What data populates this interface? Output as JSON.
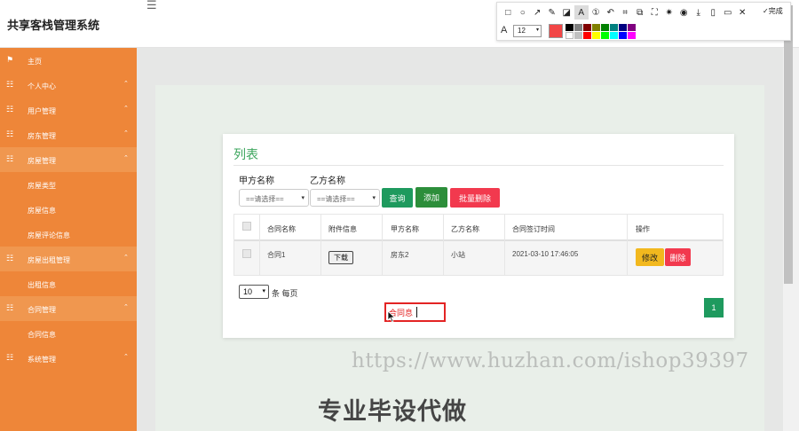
{
  "app": {
    "title": "共享客栈管理系统"
  },
  "sidebar": {
    "items": [
      {
        "label": "主页",
        "icon": "flag-icon",
        "type": "item",
        "arrow": ""
      },
      {
        "label": "个人中心",
        "icon": "grid-icon",
        "type": "item",
        "arrow": "⌃"
      },
      {
        "label": "用户管理",
        "icon": "grid-icon",
        "type": "item",
        "arrow": "⌃"
      },
      {
        "label": "房东管理",
        "icon": "grid-icon",
        "type": "item",
        "arrow": "⌃"
      },
      {
        "label": "房屋管理",
        "icon": "grid-icon",
        "type": "group",
        "arrow": "⌃"
      },
      {
        "label": "房屋类型",
        "type": "sub"
      },
      {
        "label": "房屋信息",
        "type": "sub"
      },
      {
        "label": "房屋评论信息",
        "type": "sub"
      },
      {
        "label": "房屋出租管理",
        "icon": "grid-icon",
        "type": "group",
        "arrow": "⌃"
      },
      {
        "label": "出租信息",
        "type": "sub"
      },
      {
        "label": "合同管理",
        "icon": "grid-icon",
        "type": "group",
        "arrow": "⌃"
      },
      {
        "label": "合同信息",
        "type": "sub"
      },
      {
        "label": "系统管理",
        "icon": "grid-icon",
        "type": "item",
        "arrow": "⌃"
      }
    ]
  },
  "main": {
    "card_title": "列表",
    "filters": {
      "party_a_label": "甲方名称",
      "party_a_value": "==请选择==",
      "party_b_label": "乙方名称",
      "party_b_value": "==请选择=="
    },
    "buttons": {
      "search": "查询",
      "add": "添加",
      "batch_delete": "批量删除"
    },
    "table": {
      "headers": [
        "合同名称",
        "附件信息",
        "甲方名称",
        "乙方名称",
        "合同签订时间",
        "操作"
      ],
      "rows": [
        {
          "contract_name": "合同1",
          "attachment": "下载",
          "party_a": "房东2",
          "party_b": "小站",
          "signed_at": "2021-03-10 17:46:05",
          "edit": "修改",
          "delete": "删除"
        }
      ]
    },
    "pager": {
      "page_size": "10",
      "per_page_text": "条 每页",
      "current_page": "1"
    }
  },
  "annotation": {
    "text": "合同息"
  },
  "overlay": {
    "watermark": "https://www.huzhan.com/ishop39397",
    "promo": "专业毕设代做"
  },
  "toolbar": {
    "icons": [
      "rectangle-icon",
      "ellipse-icon",
      "arrow-icon",
      "pen-icon",
      "mosaic-icon",
      "text-icon",
      "step-icon",
      "undo-icon",
      "crop-icon",
      "resize-icon",
      "fullscreen-icon",
      "pin-icon",
      "record-icon",
      "download-icon",
      "copy-icon",
      "bookmark-icon",
      "close-icon"
    ],
    "done_label": "完成",
    "font_size": "12",
    "current_color": "#f24646",
    "palette": [
      "#000000",
      "#808080",
      "#800000",
      "#808000",
      "#008000",
      "#008080",
      "#000080",
      "#800080",
      "#ffffff",
      "#c0c0c0",
      "#ff0000",
      "#ffff00",
      "#00ff00",
      "#00ffff",
      "#0000ff",
      "#ff00ff"
    ]
  },
  "colors": {
    "sidebar": "#ee8639",
    "accent_green": "#3ba55c",
    "primary_btn": "#1e9a5e",
    "danger": "#f2394e",
    "warning": "#f2b81e"
  }
}
